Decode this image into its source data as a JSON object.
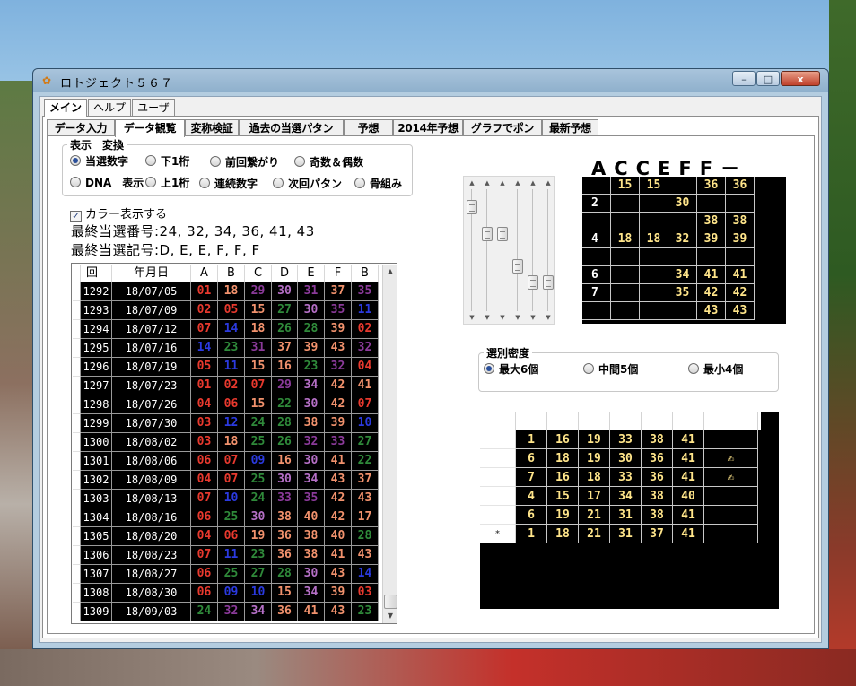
{
  "window": {
    "title": "ロトジェクト５６７",
    "minimize": "–",
    "maximize": "□",
    "close": "x"
  },
  "menu_tabs": [
    "メイン",
    "ヘルプ",
    "ユーザ"
  ],
  "sub_tabs": [
    "データ入力",
    "データ観覧",
    "変称検証",
    "過去の当選パタン",
    "予想",
    "2014年予想",
    "グラフでポン",
    "最新予想"
  ],
  "display_group": {
    "legend": "表示　変換",
    "options": [
      "当選数字",
      "下1桁",
      "前回繋がり",
      "奇数＆偶数",
      "DNA　表示",
      "上1桁",
      "連続数字",
      "次回パタン",
      "骨組み"
    ],
    "selected": "当選数字"
  },
  "color_checkbox": {
    "label": "カラー表示する",
    "checked": true,
    "mark": "✓"
  },
  "last_numbers": "最終当選番号:24, 32, 34, 36, 41, 43",
  "last_symbols": "最終当選記号:D, E, E, F, F, F",
  "colors": {
    "red": "#e8392e",
    "salmon": "#f2926d",
    "purple": "#8b3a9a",
    "green": "#2f8a3a",
    "blue": "#2b3ae0",
    "orchid": "#b56fc6",
    "yellow": "#ffe58a"
  },
  "data_table": {
    "headers": [
      "回",
      "年月日",
      "A",
      "B",
      "C",
      "D",
      "E",
      "F",
      "B"
    ],
    "rows": [
      {
        "no": "1292",
        "date": "18/07/05",
        "nums": [
          [
            "01",
            "red"
          ],
          [
            "18",
            "salmon"
          ],
          [
            "29",
            "purple"
          ],
          [
            "30",
            "orchid"
          ],
          [
            "31",
            "purple"
          ],
          [
            "37",
            "salmon"
          ],
          [
            "35",
            "purple"
          ]
        ]
      },
      {
        "no": "1293",
        "date": "18/07/09",
        "nums": [
          [
            "02",
            "red"
          ],
          [
            "05",
            "red"
          ],
          [
            "15",
            "salmon"
          ],
          [
            "27",
            "green"
          ],
          [
            "30",
            "orchid"
          ],
          [
            "35",
            "purple"
          ],
          [
            "11",
            "blue"
          ]
        ]
      },
      {
        "no": "1294",
        "date": "18/07/12",
        "nums": [
          [
            "07",
            "red"
          ],
          [
            "14",
            "blue"
          ],
          [
            "18",
            "salmon"
          ],
          [
            "26",
            "green"
          ],
          [
            "28",
            "green"
          ],
          [
            "39",
            "salmon"
          ],
          [
            "02",
            "red"
          ]
        ]
      },
      {
        "no": "1295",
        "date": "18/07/16",
        "nums": [
          [
            "14",
            "blue"
          ],
          [
            "23",
            "green"
          ],
          [
            "31",
            "purple"
          ],
          [
            "37",
            "salmon"
          ],
          [
            "39",
            "salmon"
          ],
          [
            "43",
            "salmon"
          ],
          [
            "32",
            "purple"
          ]
        ]
      },
      {
        "no": "1296",
        "date": "18/07/19",
        "nums": [
          [
            "05",
            "red"
          ],
          [
            "11",
            "blue"
          ],
          [
            "15",
            "salmon"
          ],
          [
            "16",
            "salmon"
          ],
          [
            "23",
            "green"
          ],
          [
            "32",
            "purple"
          ],
          [
            "04",
            "red"
          ]
        ]
      },
      {
        "no": "1297",
        "date": "18/07/23",
        "nums": [
          [
            "01",
            "red"
          ],
          [
            "02",
            "red"
          ],
          [
            "07",
            "red"
          ],
          [
            "29",
            "purple"
          ],
          [
            "34",
            "orchid"
          ],
          [
            "42",
            "salmon"
          ],
          [
            "41",
            "salmon"
          ]
        ]
      },
      {
        "no": "1298",
        "date": "18/07/26",
        "nums": [
          [
            "04",
            "red"
          ],
          [
            "06",
            "red"
          ],
          [
            "15",
            "salmon"
          ],
          [
            "22",
            "green"
          ],
          [
            "30",
            "orchid"
          ],
          [
            "42",
            "salmon"
          ],
          [
            "07",
            "red"
          ]
        ]
      },
      {
        "no": "1299",
        "date": "18/07/30",
        "nums": [
          [
            "03",
            "red"
          ],
          [
            "12",
            "blue"
          ],
          [
            "24",
            "green"
          ],
          [
            "28",
            "green"
          ],
          [
            "38",
            "salmon"
          ],
          [
            "39",
            "salmon"
          ],
          [
            "10",
            "blue"
          ]
        ]
      },
      {
        "no": "1300",
        "date": "18/08/02",
        "nums": [
          [
            "03",
            "red"
          ],
          [
            "18",
            "salmon"
          ],
          [
            "25",
            "green"
          ],
          [
            "26",
            "green"
          ],
          [
            "32",
            "purple"
          ],
          [
            "33",
            "purple"
          ],
          [
            "27",
            "green"
          ]
        ]
      },
      {
        "no": "1301",
        "date": "18/08/06",
        "nums": [
          [
            "06",
            "red"
          ],
          [
            "07",
            "red"
          ],
          [
            "09",
            "blue"
          ],
          [
            "16",
            "salmon"
          ],
          [
            "30",
            "orchid"
          ],
          [
            "41",
            "salmon"
          ],
          [
            "22",
            "green"
          ]
        ]
      },
      {
        "no": "1302",
        "date": "18/08/09",
        "nums": [
          [
            "04",
            "red"
          ],
          [
            "07",
            "red"
          ],
          [
            "25",
            "green"
          ],
          [
            "30",
            "orchid"
          ],
          [
            "34",
            "orchid"
          ],
          [
            "43",
            "salmon"
          ],
          [
            "37",
            "salmon"
          ]
        ]
      },
      {
        "no": "1303",
        "date": "18/08/13",
        "nums": [
          [
            "07",
            "red"
          ],
          [
            "10",
            "blue"
          ],
          [
            "24",
            "green"
          ],
          [
            "33",
            "purple"
          ],
          [
            "35",
            "purple"
          ],
          [
            "42",
            "salmon"
          ],
          [
            "43",
            "salmon"
          ]
        ]
      },
      {
        "no": "1304",
        "date": "18/08/16",
        "nums": [
          [
            "06",
            "red"
          ],
          [
            "25",
            "green"
          ],
          [
            "30",
            "orchid"
          ],
          [
            "38",
            "salmon"
          ],
          [
            "40",
            "salmon"
          ],
          [
            "42",
            "salmon"
          ],
          [
            "17",
            "salmon"
          ]
        ]
      },
      {
        "no": "1305",
        "date": "18/08/20",
        "nums": [
          [
            "04",
            "red"
          ],
          [
            "06",
            "red"
          ],
          [
            "19",
            "salmon"
          ],
          [
            "36",
            "salmon"
          ],
          [
            "38",
            "salmon"
          ],
          [
            "40",
            "salmon"
          ],
          [
            "28",
            "green"
          ]
        ]
      },
      {
        "no": "1306",
        "date": "18/08/23",
        "nums": [
          [
            "07",
            "red"
          ],
          [
            "11",
            "blue"
          ],
          [
            "23",
            "green"
          ],
          [
            "36",
            "salmon"
          ],
          [
            "38",
            "salmon"
          ],
          [
            "41",
            "salmon"
          ],
          [
            "43",
            "salmon"
          ]
        ]
      },
      {
        "no": "1307",
        "date": "18/08/27",
        "nums": [
          [
            "06",
            "red"
          ],
          [
            "25",
            "green"
          ],
          [
            "27",
            "green"
          ],
          [
            "28",
            "green"
          ],
          [
            "30",
            "orchid"
          ],
          [
            "43",
            "salmon"
          ],
          [
            "14",
            "blue"
          ]
        ]
      },
      {
        "no": "1308",
        "date": "18/08/30",
        "nums": [
          [
            "06",
            "red"
          ],
          [
            "09",
            "blue"
          ],
          [
            "10",
            "blue"
          ],
          [
            "15",
            "salmon"
          ],
          [
            "34",
            "orchid"
          ],
          [
            "39",
            "salmon"
          ],
          [
            "03",
            "red"
          ]
        ]
      },
      {
        "no": "1309",
        "date": "18/09/03",
        "nums": [
          [
            "24",
            "green"
          ],
          [
            "32",
            "purple"
          ],
          [
            "34",
            "orchid"
          ],
          [
            "36",
            "salmon"
          ],
          [
            "41",
            "salmon"
          ],
          [
            "43",
            "salmon"
          ],
          [
            "23",
            "green"
          ]
        ]
      }
    ],
    "scroll_up": "▲",
    "scroll_down": "▼"
  },
  "sliders": [
    {
      "level": 0.1
    },
    {
      "level": 0.35
    },
    {
      "level": 0.35
    },
    {
      "level": 0.65
    },
    {
      "level": 0.8
    },
    {
      "level": 0.8
    }
  ],
  "slider_arrows": {
    "up": "▲",
    "down": "▼"
  },
  "big_label": "ACCEFF－",
  "black_grid": {
    "rows": [
      [
        "",
        "15",
        "15",
        "",
        "36",
        "36"
      ],
      [
        "2",
        "",
        "",
        "30",
        "",
        ""
      ],
      [
        "",
        "",
        "",
        "",
        "38",
        "38"
      ],
      [
        "4",
        "18",
        "18",
        "32",
        "39",
        "39"
      ],
      [
        "",
        "",
        "",
        "",
        "",
        ""
      ],
      [
        "6",
        "",
        "",
        "34",
        "41",
        "41"
      ],
      [
        "7",
        "",
        "",
        "35",
        "42",
        "42"
      ],
      [
        "",
        "",
        "",
        "",
        "43",
        "43"
      ]
    ]
  },
  "density_group": {
    "legend": "選別密度",
    "options": [
      "最大6個",
      "中間5個",
      "最小4個"
    ],
    "selected": "最大6個"
  },
  "result_grid": {
    "rows": [
      {
        "nums": [
          "1",
          "16",
          "19",
          "33",
          "38",
          "41"
        ],
        "mark": ""
      },
      {
        "nums": [
          "6",
          "18",
          "19",
          "30",
          "36",
          "41"
        ],
        "mark": "✍"
      },
      {
        "nums": [
          "7",
          "16",
          "18",
          "33",
          "36",
          "41"
        ],
        "mark": "✍"
      },
      {
        "nums": [
          "4",
          "15",
          "17",
          "34",
          "38",
          "40"
        ],
        "mark": ""
      },
      {
        "nums": [
          "6",
          "19",
          "21",
          "31",
          "38",
          "41"
        ],
        "mark": ""
      },
      {
        "nums": [
          "1",
          "18",
          "21",
          "31",
          "37",
          "41"
        ],
        "mark": ""
      }
    ],
    "new_row_marker": "*"
  }
}
